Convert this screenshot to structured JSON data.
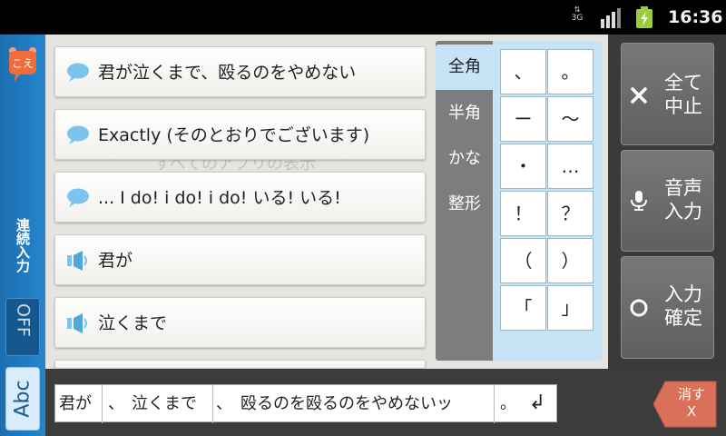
{
  "status_bar": {
    "network": "3G",
    "time": "16:36",
    "icons": [
      "3g-data-icon",
      "signal-icon",
      "battery-charging-icon"
    ]
  },
  "sidebar": {
    "logo_text": "こえ",
    "continuous_input_label": "連続入力",
    "continuous_toggle_state": "OFF",
    "keyboard_button_label": "Abc"
  },
  "background_hint": "すべてのアプリの表示",
  "candidates": [
    {
      "icon": "speech-bubble-icon",
      "text": "君が泣くまで、殴るのをやめない"
    },
    {
      "icon": "speech-bubble-icon",
      "text": "Exactly (そのとおりでございます)"
    },
    {
      "icon": "speech-bubble-icon",
      "text": "... I do! i do! i do! いる! いる!"
    },
    {
      "icon": "speaker-icon",
      "text": "君が"
    },
    {
      "icon": "speaker-icon",
      "text": "泣くまで"
    }
  ],
  "categories": [
    {
      "label": "全角",
      "active": true
    },
    {
      "label": "半角",
      "active": false
    },
    {
      "label": "かな",
      "active": false
    },
    {
      "label": "整形",
      "active": false
    }
  ],
  "symbols": [
    "、",
    "。",
    "ー",
    "～",
    "・",
    "…",
    "！",
    "？",
    "（",
    "）",
    "「",
    "」"
  ],
  "actions": {
    "cancel_all": "全て中止",
    "voice_input": "音声入力",
    "confirm_input": "入力確定"
  },
  "composition": {
    "segments": [
      "君が",
      "、",
      "泣くまで",
      "、",
      "殴るのを殴るのをやめないッ",
      "。"
    ],
    "enter_symbol": "↲"
  },
  "erase_button": {
    "label": "消す",
    "sub": "X"
  },
  "colors": {
    "sidebar_blue": "#2585cc",
    "candidate_panel": "#e6e4df",
    "symbol_panel": "#c7e4f6",
    "erase_button": "#d9705a"
  }
}
